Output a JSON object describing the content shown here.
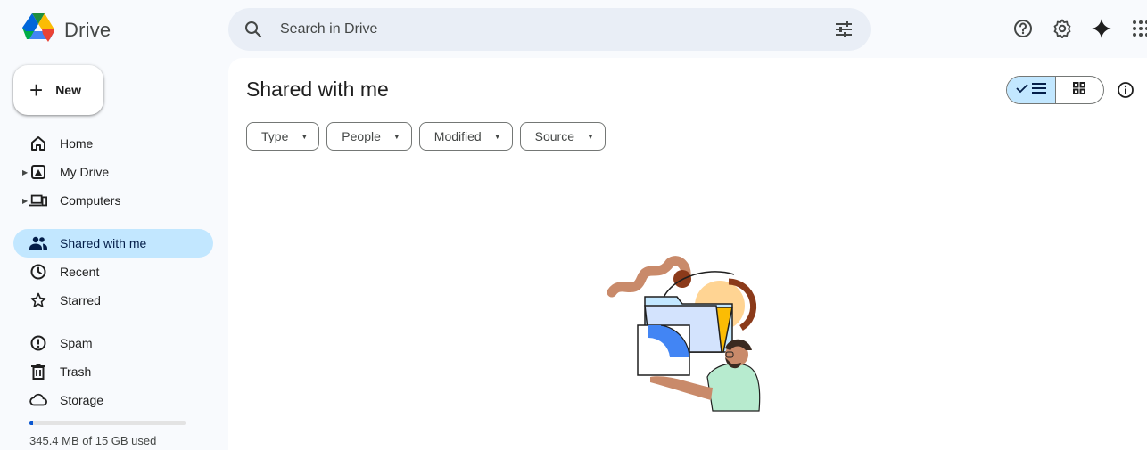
{
  "app": {
    "name": "Drive"
  },
  "search": {
    "placeholder": "Search in Drive"
  },
  "top_icons": [
    "help-icon",
    "settings-icon",
    "gemini-sparkle-icon",
    "apps-grid-icon"
  ],
  "new_button": {
    "label": "New"
  },
  "sidebar": {
    "items": [
      {
        "label": "Home",
        "icon": "home-icon"
      },
      {
        "label": "My Drive",
        "icon": "my-drive-icon",
        "expandable": true
      },
      {
        "label": "Computers",
        "icon": "computers-icon",
        "expandable": true
      },
      {
        "label": "Shared with me",
        "icon": "shared-people-icon",
        "active": true
      },
      {
        "label": "Recent",
        "icon": "clock-icon"
      },
      {
        "label": "Starred",
        "icon": "star-icon"
      },
      {
        "label": "Spam",
        "icon": "spam-icon"
      },
      {
        "label": "Trash",
        "icon": "trash-icon"
      },
      {
        "label": "Storage",
        "icon": "cloud-icon"
      }
    ],
    "storage": {
      "text": "345.4 MB of 15 GB used",
      "used_fraction": 0.023
    }
  },
  "main": {
    "title": "Shared with me",
    "filters": [
      {
        "label": "Type"
      },
      {
        "label": "People"
      },
      {
        "label": "Modified"
      },
      {
        "label": "Source"
      }
    ],
    "view": {
      "selected": "list"
    }
  },
  "colors": {
    "accent": "#0b57d0",
    "active_nav": "#c2e7ff",
    "search_bg": "#e9eef6",
    "page_bg": "#f8fafd"
  }
}
